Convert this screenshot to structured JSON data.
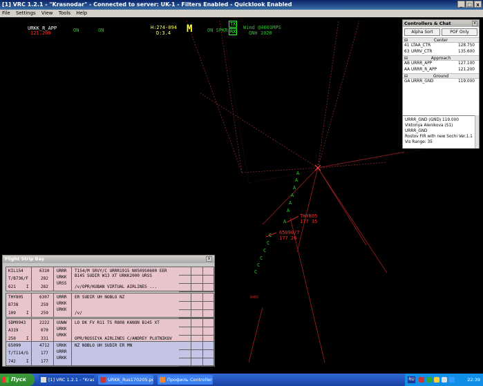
{
  "window": {
    "title": "[1] VRC 1.2.1 - \"Krasnodar\" - Connected to server: UK-1 - Filters Enabled - Quicklook Enabled",
    "controls": [
      "_",
      "□",
      "x"
    ]
  },
  "menu": [
    "File",
    "Settings",
    "View",
    "Tools",
    "Help"
  ],
  "scope_header": {
    "position": "URKK_R_APP",
    "frequency": "121.200",
    "on1": "ON",
    "on2": "ON",
    "heading_line": "H:274-094",
    "distance_line": "D:3.4",
    "mode_letter": "M",
    "on_spkr": "ON SPKR",
    "tx": "TX",
    "rx": "RX",
    "wind": "Wind @4001MPS",
    "qnh": "QNH 1020"
  },
  "targets": [
    {
      "callsign": "THY805",
      "data": "177 35",
      "color": "#ff3030"
    },
    {
      "callsign": "65090/7",
      "data": "177 26",
      "color": "#ff3030"
    }
  ],
  "track_letters": {
    "a": "A",
    "c": "C"
  },
  "misc_labels": {
    "fix": "8485"
  },
  "controllers": {
    "title": "Controllers & Chat",
    "close": "x",
    "buttons": [
      "Alpha Sort",
      "POF Only"
    ],
    "groups": [
      {
        "name": "Center",
        "toggle": "⊟",
        "rows": [
          {
            "id": "41",
            "callsign": "LTAA_CTR",
            "freq": "128.750"
          },
          {
            "id": "63",
            "callsign": "URRV_CTR",
            "freq": "135.600"
          }
        ]
      },
      {
        "name": "Approach",
        "toggle": "⊟",
        "rows": [
          {
            "id": "AB",
            "callsign": "URRR_APP",
            "freq": "127.100"
          },
          {
            "id": "AA",
            "callsign": "URRR_R_APP",
            "freq": "121.200"
          }
        ]
      },
      {
        "name": "Ground",
        "toggle": "⊟",
        "rows": [
          {
            "id": "GA",
            "callsign": "URRR_GND",
            "freq": "119.000"
          }
        ]
      }
    ],
    "info": [
      "URRR_GND (GND) 119.000",
      "Viktoriya Alenikova (S1)",
      "URRR_GND",
      "Rostov FIR with new Sochi Ver.1.1",
      "Vis Range: 35"
    ]
  },
  "strip_bay": {
    "title": "Flight Strip Bay",
    "close": "x",
    "strips": [
      {
        "color": "pink",
        "callsign": "KIL154",
        "type": "T/B736/F",
        "cid": "621",
        "flag": "I",
        "squawk": "6310",
        "ete": "282",
        "alt": "282",
        "dep": "URRR",
        "dest": "URKK",
        "alt_ap": "URSS",
        "route": "T154/M SRVY/C URRR1915 N0509S0600 EER B145 SUDIR W13 XT URKK2000 URSS",
        "remarks": "/v/OPR/KUBAN VIRTUAL AIRLINES ..."
      },
      {
        "color": "pink",
        "callsign": "THY805",
        "type": "B738",
        "cid": "109",
        "flag": "I",
        "squawk": "6307",
        "ete": "259",
        "alt": "259",
        "dep": "URRR",
        "dest": "URKK",
        "alt_ap": "URKK",
        "route": "ER SUDIR UH NOBLO NZ",
        "remarks": "/v/"
      },
      {
        "color": "pink",
        "callsign": "SDM9943",
        "type": "A319",
        "cid": "250",
        "flag": "I",
        "squawk": "2222",
        "ete": "070",
        "alt": "331",
        "dep": "UUWW",
        "dest": "URKK",
        "alt_ap": "URKK",
        "route": "LO DK FV R11 TS R808 KANON B145 XT",
        "remarks": "OPR/ROSSIYA AIRLINES C/ANDREY PLOTNIKOV"
      },
      {
        "color": "blue",
        "callsign": "65090",
        "type": "T/T114/G",
        "cid": "742",
        "flag": "I",
        "squawk": "4712",
        "ete": "177",
        "alt": "177",
        "dep": "URKK",
        "dest": "URRR",
        "alt_ap": "URKK",
        "route": "NZ NOBLO UH SUDIR ER MN",
        "remarks": ""
      }
    ]
  },
  "taskbar": {
    "start": "Пуск",
    "tasks": [
      "[1] VRC 1.2.1 - \"Kras...",
      "URKK_Rus170205.pd...",
      "Профиль Controller -..."
    ],
    "lang": "RU",
    "clock": "22:39"
  }
}
